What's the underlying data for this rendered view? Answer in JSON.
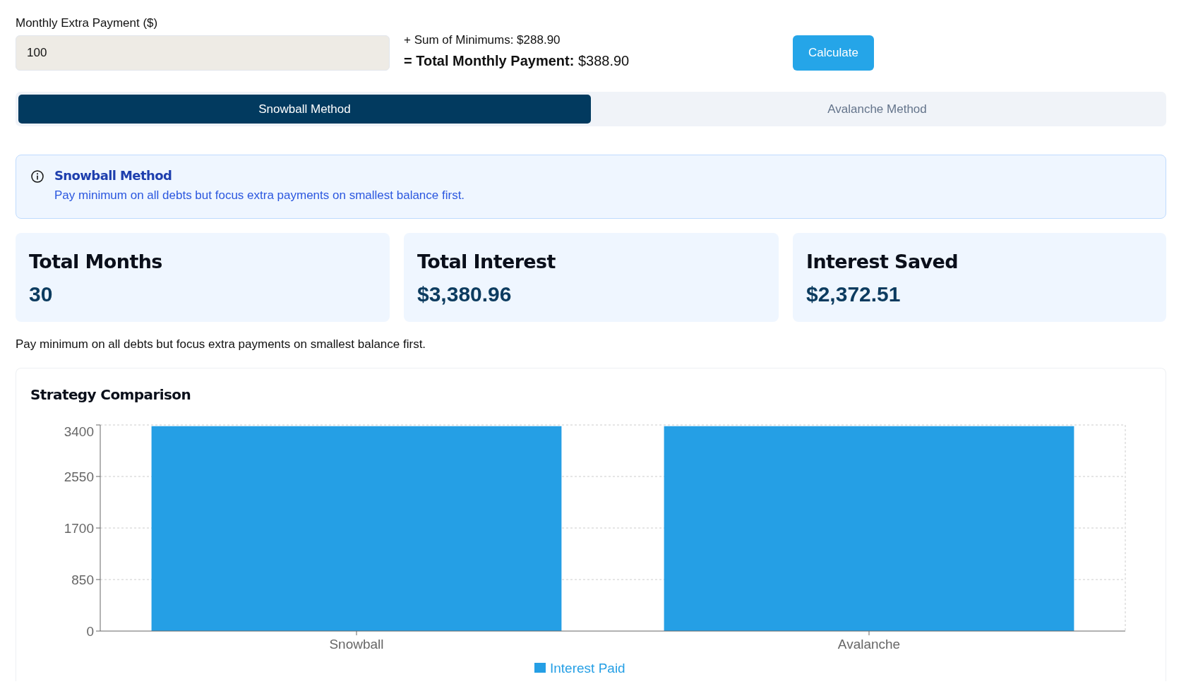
{
  "extra_payment": {
    "label": "Monthly Extra Payment ($)",
    "value": "100"
  },
  "summary": {
    "sum_of_minimums": "+ Sum of Minimums: $288.90",
    "total_monthly_payment": "**= Total Monthly Payment:** $388.90"
  },
  "calculate_button": {
    "label": "Calculate"
  },
  "tabs": [
    {
      "label": "Snowball Method",
      "selected": true
    },
    {
      "label": "Avalanche Method",
      "selected": false
    }
  ],
  "info_box": {
    "title": "Snowball Method",
    "text": "Pay minimum on all debts but focus extra payments on smallest balance first."
  },
  "stats": [
    {
      "label": "Total Months",
      "value": "30"
    },
    {
      "label": "Total Interest",
      "value": "$3,380.96"
    },
    {
      "label": "Interest Saved",
      "value": "$2,372.51"
    }
  ],
  "description": "Pay minimum on all debts but focus extra payments on smallest balance first.",
  "chart": {
    "chart_data": {
      "type": "bar",
      "title": "Strategy Comparison",
      "categories": [
        "Snowball",
        "Avalanche"
      ],
      "series": [
        {
          "name": "Interest Paid",
          "color": "#259fe5",
          "values": [
            3380,
            3380
          ]
        }
      ],
      "ylim": [
        0,
        3400
      ],
      "yticks": [
        0,
        850,
        1700,
        2550,
        3400
      ],
      "grid": true
    }
  }
}
